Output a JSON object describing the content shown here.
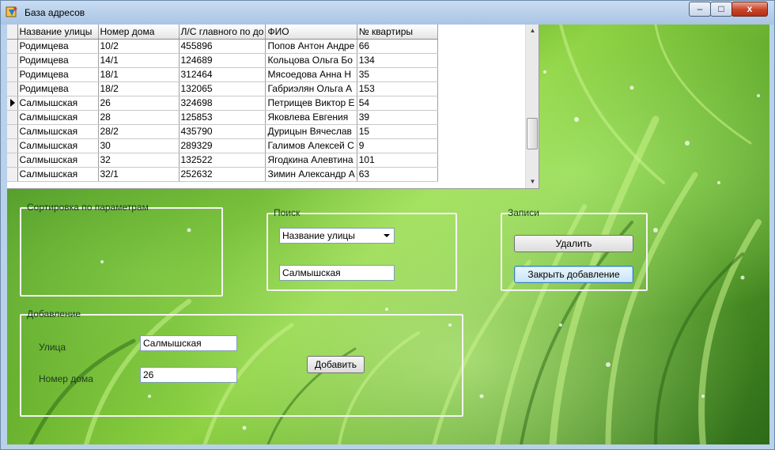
{
  "window": {
    "title": "База адресов",
    "minimize": "–",
    "maximize": "□",
    "close": "x"
  },
  "grid": {
    "columns": [
      "Название улицы",
      "Номер дома",
      "Л/С главного по до",
      "ФИО",
      "№ квартиры"
    ],
    "rows": [
      [
        "Родимцева",
        "10/2",
        "455896",
        "Попов Антон Андре",
        "66"
      ],
      [
        "Родимцева",
        "14/1",
        "124689",
        "Кольцова Ольга Бо",
        "134"
      ],
      [
        "Родимцева",
        "18/1",
        "312464",
        "Мясоедова Анна Н",
        "35"
      ],
      [
        "Родимцева",
        "18/2",
        "132065",
        "Габриэлян Ольга А",
        "153"
      ],
      [
        "Салмышская",
        "26",
        "324698",
        "Петрищев Виктор Е",
        "54"
      ],
      [
        "Салмышская",
        "28",
        "125853",
        "Яковлева Евгения",
        "39"
      ],
      [
        "Салмышская",
        "28/2",
        "435790",
        "Дурицын Вячеслав",
        "15"
      ],
      [
        "Салмышская",
        "30",
        "289329",
        "Галимов Алексей С",
        "9"
      ],
      [
        "Салмышская",
        "32",
        "132522",
        "Ягодкина Алевтина",
        "101"
      ],
      [
        "Салмышская",
        "32/1",
        "252632",
        "Зимин Александр А",
        "63"
      ]
    ],
    "current_row": 4
  },
  "sort_group": {
    "legend": "Сортировка по параметрам"
  },
  "search_group": {
    "legend": "Поиск",
    "field_selected": "Название улицы",
    "search_value": "Салмышская"
  },
  "records_group": {
    "legend": "Записи",
    "delete_label": "Удалить",
    "close_add_label": "Закрыть добавление"
  },
  "add_group": {
    "legend": "Добавление",
    "street_label": "Улица",
    "street_value": "Салмышская",
    "house_label": "Номер дома",
    "house_value": "26",
    "add_label": "Добавить"
  }
}
